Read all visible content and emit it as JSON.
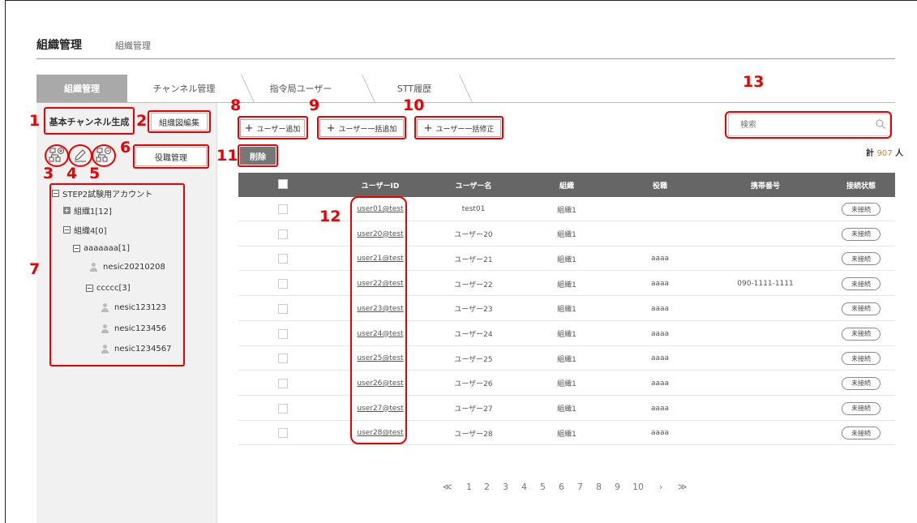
{
  "header": {
    "title": "組織管理",
    "breadcrumb": "組織管理"
  },
  "tabs": [
    {
      "label": "組織管理",
      "active": true
    },
    {
      "label": "チャンネル管理",
      "active": false
    },
    {
      "label": "指令局ユーザー",
      "active": false
    },
    {
      "label": "STT履歴",
      "active": false
    }
  ],
  "left_panel": {
    "basic_channel_label": "基本チャンネル生成",
    "org_chart_edit_label": "組織図編集",
    "position_mgmt_label": "役職管理",
    "tools": [
      {
        "icon": "add-org-icon"
      },
      {
        "icon": "edit-pencil-icon"
      },
      {
        "icon": "remove-org-icon"
      }
    ],
    "tree": [
      {
        "label": "STEP2試験用アカウント",
        "node": "minus"
      },
      {
        "label": "組織1[12]",
        "node": "plus"
      },
      {
        "label": "組織4[0]",
        "node": "minus"
      },
      {
        "label": "aaaaaaa[1]",
        "node": "minus"
      },
      {
        "label": "nesic20210208",
        "node": "user"
      },
      {
        "label": "ccccc[3]",
        "node": "minus"
      },
      {
        "label": "nesic123123",
        "node": "user"
      },
      {
        "label": "nesic123456",
        "node": "user"
      },
      {
        "label": "nesic1234567",
        "node": "user"
      }
    ]
  },
  "toolbar": {
    "add_user_label": "ユーザー追加",
    "bulk_add_label": "ユーザー一括追加",
    "bulk_edit_label": "ユーザー一括修正",
    "delete_label": "削除",
    "search_placeholder": "検索",
    "count_prefix": "計",
    "count_value": "907",
    "count_suffix": "人"
  },
  "table": {
    "columns": [
      "ユーザーID",
      "ユーザー名",
      "組織",
      "役職",
      "携帯番号",
      "接続状態"
    ],
    "rows": [
      {
        "uid": "user01@test",
        "name": "test01",
        "org": "組織1",
        "role": "",
        "phone": "",
        "status": "未接続"
      },
      {
        "uid": "user20@test",
        "name": "ユーザー20",
        "org": "組織1",
        "role": "",
        "phone": "",
        "status": "未接続"
      },
      {
        "uid": "user21@test",
        "name": "ユーザー21",
        "org": "組織1",
        "role": "aaaa",
        "phone": "",
        "status": "未接続"
      },
      {
        "uid": "user22@test",
        "name": "ユーザー22",
        "org": "組織1",
        "role": "aaaa",
        "phone": "090-1111-1111",
        "status": "未接続"
      },
      {
        "uid": "user23@test",
        "name": "ユーザー23",
        "org": "組織1",
        "role": "aaaa",
        "phone": "",
        "status": "未接続"
      },
      {
        "uid": "user24@test",
        "name": "ユーザー24",
        "org": "組織1",
        "role": "aaaa",
        "phone": "",
        "status": "未接続"
      },
      {
        "uid": "user25@test",
        "name": "ユーザー25",
        "org": "組織1",
        "role": "aaaa",
        "phone": "",
        "status": "未接続"
      },
      {
        "uid": "user26@test",
        "name": "ユーザー26",
        "org": "組織1",
        "role": "aaaa",
        "phone": "",
        "status": "未接続"
      },
      {
        "uid": "user27@test",
        "name": "ユーザー27",
        "org": "組織1",
        "role": "aaaa",
        "phone": "",
        "status": "未接続"
      },
      {
        "uid": "user28@test",
        "name": "ユーザー28",
        "org": "組織1",
        "role": "aaaa",
        "phone": "",
        "status": "未接続"
      }
    ]
  },
  "pagination": {
    "first": "≪",
    "pages": [
      "1",
      "2",
      "3",
      "4",
      "5",
      "6",
      "7",
      "8",
      "9",
      "10"
    ],
    "current": "1",
    "next": "›",
    "last": "≫"
  },
  "annotations": [
    "1",
    "2",
    "3",
    "4",
    "5",
    "6",
    "7",
    "8",
    "9",
    "10",
    "11",
    "12",
    "13"
  ],
  "colors": {
    "annotation_red": "#e00000",
    "accent_orange": "#e67e22",
    "table_header": "#666666",
    "active_tab": "#a9a9a9"
  }
}
